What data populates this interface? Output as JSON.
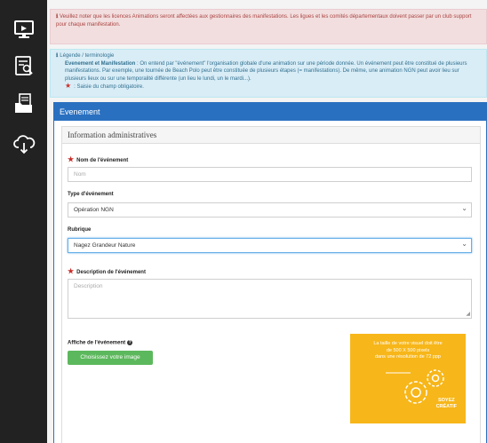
{
  "sidebar": {
    "items": [
      {
        "name": "monitor",
        "icon": "monitor-icon"
      },
      {
        "name": "search-document",
        "icon": "document-search-icon"
      },
      {
        "name": "folder-document",
        "icon": "folder-document-icon"
      },
      {
        "name": "cloud-download",
        "icon": "cloud-download-icon"
      }
    ],
    "colors": {
      "background": "#222222",
      "icon": "#ffffff"
    }
  },
  "alerts": {
    "warning_text": "Veuillez noter que les licences Animations seront affectées aux gestionnaires des manifestations. Les ligues et les comités départementaux doivent passer par un club support pour chaque manifestation.",
    "legend_title": "Légende / terminologie",
    "legend_term": "Evenement et Manifestation",
    "legend_text": " : On entend par \"événement\" l'organisation globale d'une animation sur une période donnée. Un événement peut être constitué de plusieurs manifestations. Par exemple, une tournée de Beach Polo peut être constituée de plusieurs étapes (= manifestations). De même, une animation NGN peut avoir lieu sur plusieurs lieux ou sur une temporalité différente (un lieu le lundi, un le mardi...).",
    "required_text": ": Saisie du champ obligatoire."
  },
  "panel": {
    "title": "Evenement",
    "section_title": "Information administratives"
  },
  "form": {
    "nom_label": "Nom de l'événement",
    "nom_placeholder": "Nom",
    "type_label": "Type d'événement",
    "type_value": "Opération NGN",
    "rubrique_label": "Rubrique",
    "rubrique_value": "Nagez Grandeur Nature",
    "description_label": "Description de l'événement",
    "description_placeholder": "Description",
    "affiche_label": "Affiche de l'événement",
    "choose_image_button": "Choisissez votre image"
  },
  "visual_hint": {
    "line1": "La taille de votre visuel doit être",
    "line2": "de 500 X 500 pixels",
    "line3": "dans une résolution de 72 ppp",
    "creatif_line1": "SOYEZ",
    "creatif_line2": "CRÉATIF"
  },
  "colors": {
    "primary": "#2a70c0",
    "danger_bg": "#f2dede",
    "danger_text": "#a94442",
    "info_bg": "#d9edf7",
    "info_text": "#31708f",
    "success": "#5cb85c",
    "visual_bg": "#f7b619",
    "required": "#c9302c"
  }
}
